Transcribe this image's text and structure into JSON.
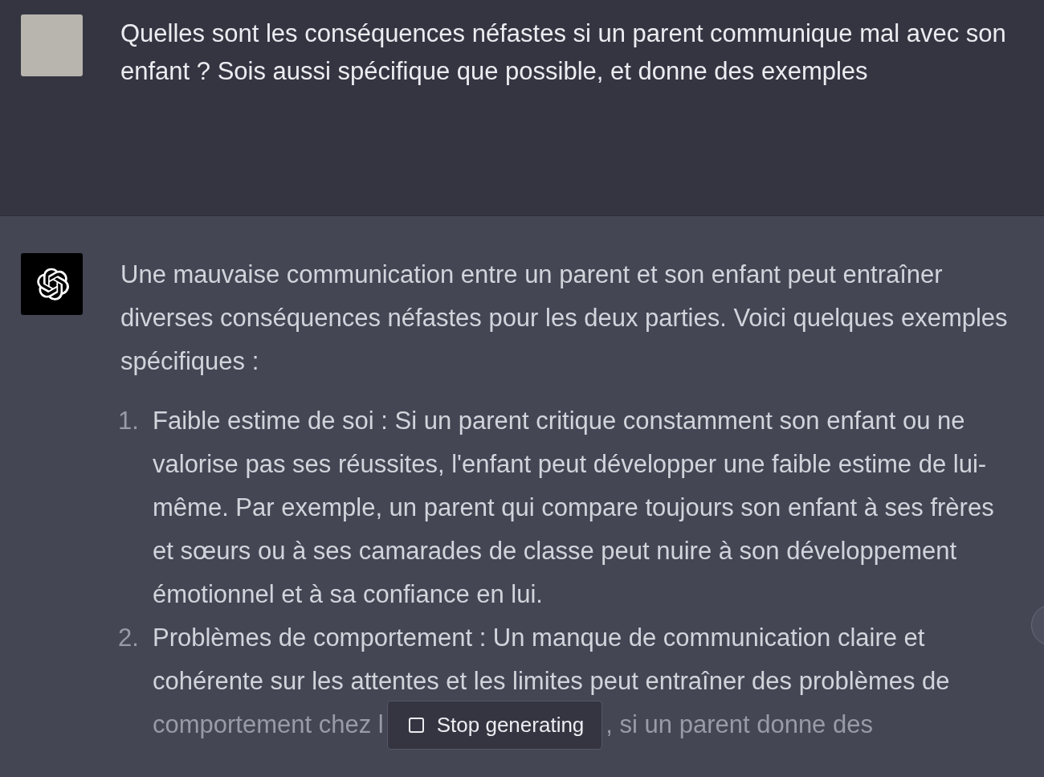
{
  "conversation": [
    {
      "kind": "user",
      "text": "Quelles sont les conséquences néfastes si un parent communique mal avec son enfant ? Sois aussi spécifique que possible, et donne des exemples"
    },
    {
      "kind": "assistant",
      "intro": "Une mauvaise communication entre un parent et son enfant peut entraîner diverses conséquences néfastes pour les deux parties. Voici quelques exemples spécifiques :",
      "items": [
        {
          "number": "1.",
          "text": "Faible estime de soi : Si un parent critique constamment son enfant ou ne valorise pas ses réussites, l'enfant peut développer une faible estime de lui-même. Par exemple, un parent qui compare toujours son enfant à ses frères et sœurs ou à ses camarades de classe peut nuire à son développement émotionnel et à sa confiance en lui."
        },
        {
          "number": "2.",
          "text": "Problèmes de comportement : Un manque de communication claire et cohérente sur les attentes et les limites peut entraîner des problèmes de",
          "text_before_button": "comportement chez l",
          "text_after_button": ", si un parent donne des"
        }
      ]
    }
  ],
  "stop_button": {
    "label": "Stop generating"
  }
}
